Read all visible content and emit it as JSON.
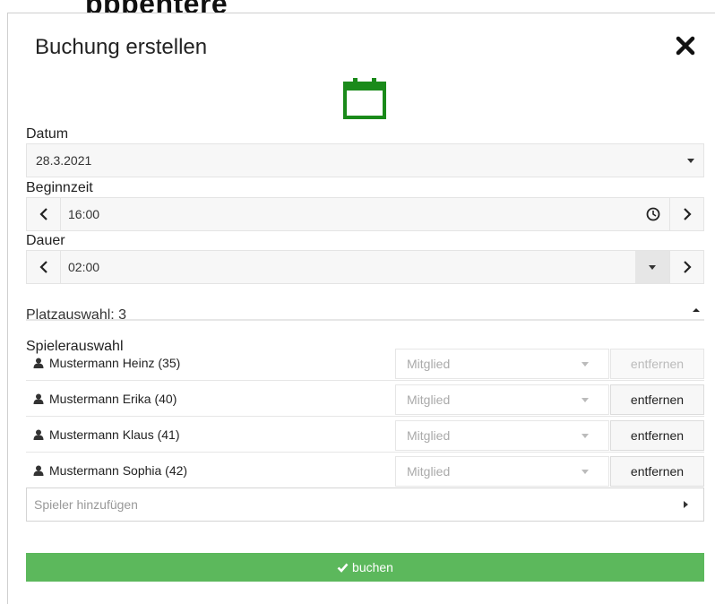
{
  "background": {
    "title_fragment": "pppentere"
  },
  "dialog": {
    "title": "Buchung erstellen"
  },
  "datum": {
    "label": "Datum",
    "value": "28.3.2021"
  },
  "beginnzeit": {
    "label": "Beginnzeit",
    "value": "16:00"
  },
  "dauer": {
    "label": "Dauer",
    "value": "02:00"
  },
  "platz": {
    "label": "Platzauswahl: 3"
  },
  "spieler": {
    "label": "Spielerauswahl",
    "rows": [
      {
        "name": "Mustermann Heinz (35)",
        "type": "Mitglied",
        "remove": "entfernen",
        "remove_enabled": false
      },
      {
        "name": "Mustermann Erika (40)",
        "type": "Mitglied",
        "remove": "entfernen",
        "remove_enabled": true
      },
      {
        "name": "Mustermann Klaus (41)",
        "type": "Mitglied",
        "remove": "entfernen",
        "remove_enabled": true
      },
      {
        "name": "Mustermann Sophia (42)",
        "type": "Mitglied",
        "remove": "entfernen",
        "remove_enabled": true
      }
    ],
    "add_placeholder": "Spieler hinzufügen"
  },
  "actions": {
    "book_label": "buchen"
  },
  "colors": {
    "accent_green": "#5cb85c",
    "icon_green": "#1a8a1a"
  },
  "icons": {
    "close": "close-icon",
    "calendar": "calendar-icon",
    "prev": "chevron-left-icon",
    "next": "chevron-right-icon",
    "clock": "clock-icon",
    "user": "user-icon",
    "check": "check-icon"
  }
}
